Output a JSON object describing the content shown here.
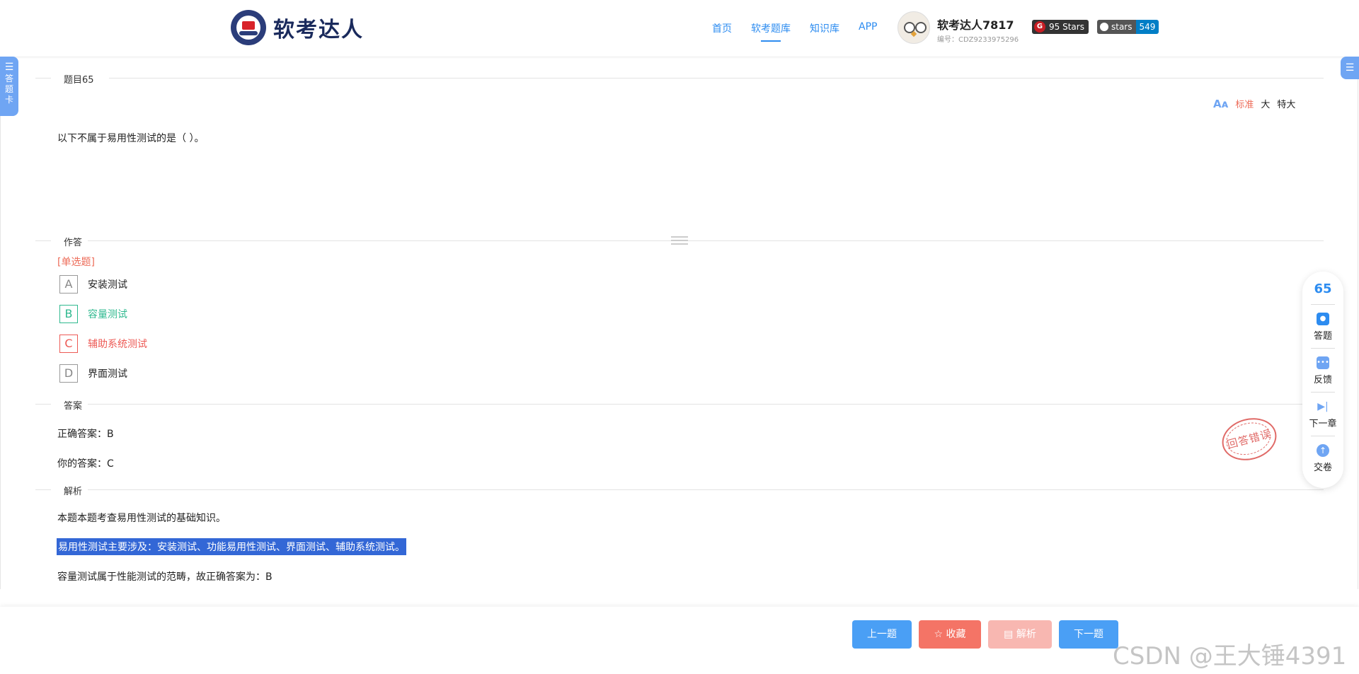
{
  "header": {
    "logo_text": "软考达人",
    "nav": [
      "首页",
      "软考题库",
      "知识库",
      "APP"
    ],
    "active_nav_index": 1,
    "user_name": "软考达人7817",
    "user_id": "编号：CDZ9233975296",
    "badge_gitee": "95 Stars",
    "badge_github_left": "stars",
    "badge_github_right": "549"
  },
  "answer_card_tab": "答题卡",
  "sections": {
    "question": "题目65",
    "answer_area": "作答",
    "answer": "答案",
    "analysis": "解析"
  },
  "font_size_options": [
    "标准",
    "大",
    "特大"
  ],
  "question_text": "以下不属于易用性测试的是（ ）。",
  "question_type": "[单选题]",
  "options": [
    {
      "letter": "A",
      "text": "安装测试",
      "state": "normal"
    },
    {
      "letter": "B",
      "text": "容量测试",
      "state": "correct"
    },
    {
      "letter": "C",
      "text": "辅助系统测试",
      "state": "wrong"
    },
    {
      "letter": "D",
      "text": "界面测试",
      "state": "normal"
    }
  ],
  "correct_answer": "正确答案：B",
  "your_answer": "你的答案：C",
  "stamp_text": "回答错误",
  "analysis_lines": [
    "本题本题考查易用性测试的基础知识。",
    "易用性测试主要涉及：安装测试、功能易用性测试、界面测试、辅助系统测试。",
    "容量测试属于性能测试的范畴，故正确答案为：B"
  ],
  "side_panel": {
    "number": "65",
    "items": [
      "答题",
      "反馈",
      "下一章",
      "交卷"
    ]
  },
  "footer_buttons": {
    "prev": "上一题",
    "favorite": "收藏",
    "analysis": "解析",
    "next": "下一题"
  },
  "watermark": "CSDN @王大锤4391",
  "colors": {
    "primary": "#2d8cf0",
    "correct": "#2fb98f",
    "wrong": "#ed5a55",
    "favorite": "#f47466",
    "highlight": "#3367d6"
  }
}
